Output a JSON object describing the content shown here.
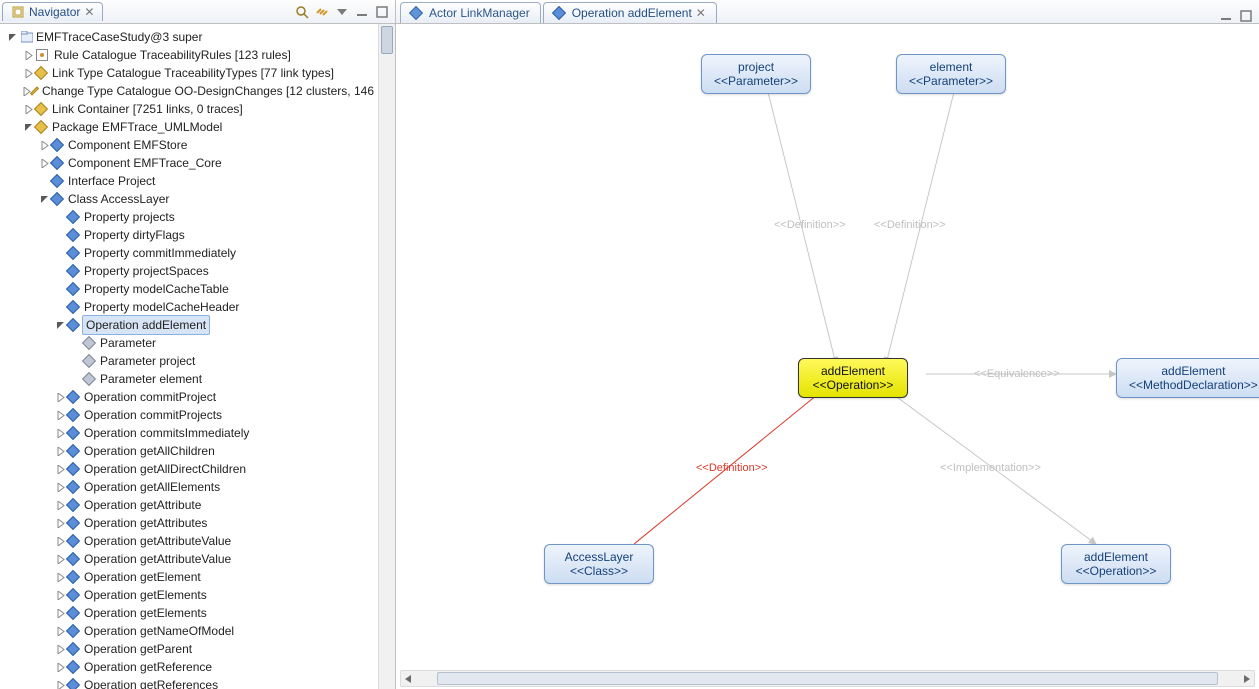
{
  "navigator": {
    "title": "Navigator",
    "root": "EMFTraceCaseStudy@3 super",
    "items": [
      {
        "ind": 1,
        "tw": "closed",
        "icon": "sq",
        "text": "Rule Catalogue TraceabilityRules [123 rules]"
      },
      {
        "ind": 1,
        "tw": "closed",
        "icon": "d-yellow",
        "text": "Link Type Catalogue TraceabilityTypes [77 link types]"
      },
      {
        "ind": 1,
        "tw": "closed",
        "icon": "d-yellow",
        "text": "Change Type Catalogue OO-DesignChanges [12 clusters, 146"
      },
      {
        "ind": 1,
        "tw": "closed",
        "icon": "d-yellow",
        "text": "Link Container [7251 links, 0 traces]"
      },
      {
        "ind": 1,
        "tw": "open",
        "icon": "d-yellow",
        "text": "Package EMFTrace_UMLModel"
      },
      {
        "ind": 2,
        "tw": "closed",
        "icon": "d-blue",
        "text": "Component EMFStore"
      },
      {
        "ind": 2,
        "tw": "closed",
        "icon": "d-blue",
        "text": "Component EMFTrace_Core"
      },
      {
        "ind": 2,
        "tw": "none",
        "icon": "d-blue",
        "text": "Interface Project"
      },
      {
        "ind": 2,
        "tw": "open",
        "icon": "d-blue",
        "text": "Class AccessLayer"
      },
      {
        "ind": 3,
        "tw": "none",
        "icon": "d-blue",
        "text": "Property projects"
      },
      {
        "ind": 3,
        "tw": "none",
        "icon": "d-blue",
        "text": "Property dirtyFlags"
      },
      {
        "ind": 3,
        "tw": "none",
        "icon": "d-blue",
        "text": "Property commitImmediately"
      },
      {
        "ind": 3,
        "tw": "none",
        "icon": "d-blue",
        "text": "Property projectSpaces"
      },
      {
        "ind": 3,
        "tw": "none",
        "icon": "d-blue",
        "text": "Property modelCacheTable"
      },
      {
        "ind": 3,
        "tw": "none",
        "icon": "d-blue",
        "text": "Property modelCacheHeader"
      },
      {
        "ind": 3,
        "tw": "open",
        "icon": "d-blue",
        "text": "Operation addElement",
        "selected": true
      },
      {
        "ind": 4,
        "tw": "none",
        "icon": "d-gray",
        "text": "Parameter"
      },
      {
        "ind": 4,
        "tw": "none",
        "icon": "d-gray",
        "text": "Parameter project"
      },
      {
        "ind": 4,
        "tw": "none",
        "icon": "d-gray",
        "text": "Parameter element"
      },
      {
        "ind": 3,
        "tw": "closed",
        "icon": "d-blue",
        "text": "Operation commitProject"
      },
      {
        "ind": 3,
        "tw": "closed",
        "icon": "d-blue",
        "text": "Operation commitProjects"
      },
      {
        "ind": 3,
        "tw": "closed",
        "icon": "d-blue",
        "text": "Operation commitsImmediately"
      },
      {
        "ind": 3,
        "tw": "closed",
        "icon": "d-blue",
        "text": "Operation getAllChildren"
      },
      {
        "ind": 3,
        "tw": "closed",
        "icon": "d-blue",
        "text": "Operation getAllDirectChildren"
      },
      {
        "ind": 3,
        "tw": "closed",
        "icon": "d-blue",
        "text": "Operation getAllElements"
      },
      {
        "ind": 3,
        "tw": "closed",
        "icon": "d-blue",
        "text": "Operation getAttribute"
      },
      {
        "ind": 3,
        "tw": "closed",
        "icon": "d-blue",
        "text": "Operation getAttributes"
      },
      {
        "ind": 3,
        "tw": "closed",
        "icon": "d-blue",
        "text": "Operation getAttributeValue"
      },
      {
        "ind": 3,
        "tw": "closed",
        "icon": "d-blue",
        "text": "Operation getAttributeValue"
      },
      {
        "ind": 3,
        "tw": "closed",
        "icon": "d-blue",
        "text": "Operation getElement"
      },
      {
        "ind": 3,
        "tw": "closed",
        "icon": "d-blue",
        "text": "Operation getElements"
      },
      {
        "ind": 3,
        "tw": "closed",
        "icon": "d-blue",
        "text": "Operation getElements"
      },
      {
        "ind": 3,
        "tw": "closed",
        "icon": "d-blue",
        "text": "Operation getNameOfModel"
      },
      {
        "ind": 3,
        "tw": "closed",
        "icon": "d-blue",
        "text": "Operation getParent"
      },
      {
        "ind": 3,
        "tw": "closed",
        "icon": "d-blue",
        "text": "Operation getReference"
      },
      {
        "ind": 3,
        "tw": "closed",
        "icon": "d-blue",
        "text": "Operation getReferences"
      }
    ]
  },
  "editor": {
    "tabs": [
      {
        "icon": "diamond-blue",
        "label": "Actor LinkManager",
        "active": false
      },
      {
        "icon": "diamond-blue",
        "label": "Operation addElement",
        "active": true
      }
    ],
    "nodes": {
      "project": {
        "title": "project",
        "stereo": "<<Parameter>>"
      },
      "element": {
        "title": "element",
        "stereo": "<<Parameter>>"
      },
      "addElOp": {
        "title": "addElement",
        "stereo": "<<Operation>>"
      },
      "addElMd": {
        "title": "addElement",
        "stereo": "<<MethodDeclaration>>"
      },
      "access": {
        "title": "AccessLayer",
        "stereo": "<<Class>>"
      },
      "addElOp2": {
        "title": "addElement",
        "stereo": "<<Operation>>"
      }
    },
    "edgeLabels": {
      "def1": "<<Definition>>",
      "def2": "<<Definition>>",
      "equiv": "<<Equivalence>>",
      "defRed": "<<Definition>>",
      "impl": "<<Implementation>>"
    }
  }
}
